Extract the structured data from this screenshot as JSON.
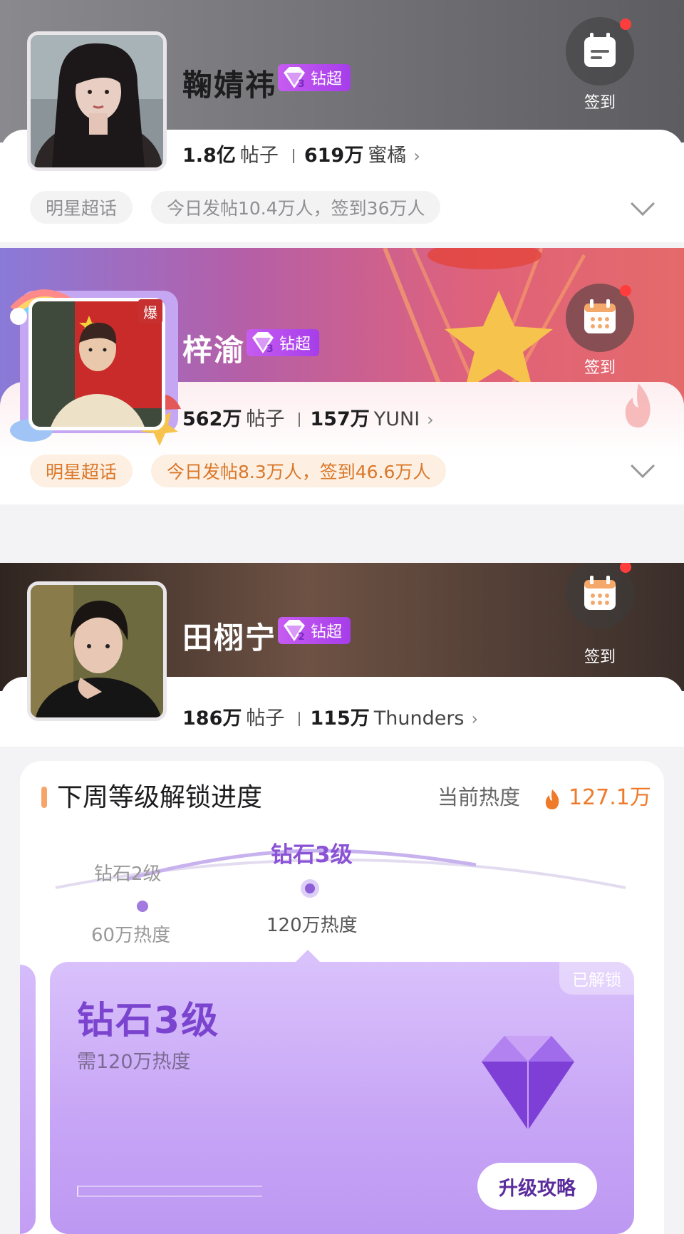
{
  "cards": [
    {
      "name": "鞠婧祎",
      "badge": "钻超",
      "badge_level": "3",
      "posts_count": "1.8亿",
      "posts_label": "帖子",
      "fans_count": "619万",
      "fans_label": "蜜橘",
      "category_tag": "明星超话",
      "activity": "今日发帖10.4万人，签到36万人",
      "checkin_label": "签到"
    },
    {
      "name": "梓渝",
      "badge": "钻超",
      "badge_level": "3",
      "hot_badge": "爆",
      "posts_count": "562万",
      "posts_label": "帖子",
      "fans_count": "157万",
      "fans_label": "YUNI",
      "category_tag": "明星超话",
      "activity": "今日发帖8.3万人，签到46.6万人",
      "checkin_label": "签到"
    },
    {
      "name": "田栩宁",
      "badge": "钻超",
      "badge_level": "2",
      "posts_count": "186万",
      "posts_label": "帖子",
      "fans_count": "115万",
      "fans_label": "Thunders",
      "checkin_label": "签到"
    }
  ],
  "progress": {
    "title": "下周等级解锁进度",
    "current_heat_label": "当前热度",
    "current_heat_value": "127.1万",
    "levels": [
      {
        "name": "钻石2级",
        "requirement": "60万热度"
      },
      {
        "name": "钻石3级",
        "requirement": "120万热度"
      }
    ],
    "card": {
      "title": "钻石3级",
      "subtitle": "需120万热度",
      "status": "已解锁",
      "button": "升级攻略"
    }
  },
  "colors": {
    "accent_purple": "#8a52d4",
    "heat_orange": "#ee7a2a",
    "badge_purple": "#b24be9",
    "notify_red": "#ff3d3d"
  }
}
